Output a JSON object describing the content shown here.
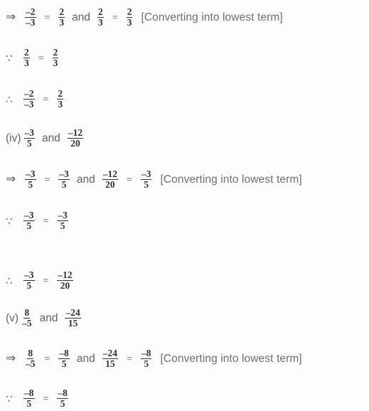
{
  "document": {
    "type": "math-solution",
    "topic": "Comparing rational numbers by converting into lowest terms",
    "background_color": "#fdfdfd",
    "math_text_color": "#2f3235",
    "prose_text_color": "#5f6368"
  },
  "symbols": {
    "implies": "⇒",
    "because": "∵",
    "therefore": "∴",
    "equals": "=",
    "and": "and"
  },
  "note_text": "[Converting into lowest term]",
  "lines": [
    {
      "id": "line-1",
      "kind": "implies",
      "symbol": "⇒",
      "left": {
        "num": "–2",
        "den": "–3"
      },
      "eq1": "=",
      "right": {
        "num": "2",
        "den": "3"
      },
      "conj": "and",
      "left2": {
        "num": "2",
        "den": "3"
      },
      "eq2": "=",
      "right2": {
        "num": "2",
        "den": "3"
      },
      "note": "[Converting into lowest term]"
    },
    {
      "id": "line-2",
      "kind": "because",
      "symbol": "∵",
      "left": {
        "num": "2",
        "den": "3"
      },
      "eq1": "=",
      "right": {
        "num": "2",
        "den": "3"
      }
    },
    {
      "id": "line-3",
      "kind": "therefore",
      "symbol": "∴",
      "left": {
        "num": "–2",
        "den": "–3"
      },
      "eq1": "=",
      "right": {
        "num": "2",
        "den": "3"
      }
    },
    {
      "id": "line-4",
      "kind": "question",
      "label": "(iv)",
      "left": {
        "num": "–3",
        "den": "5"
      },
      "conj": "and",
      "right": {
        "num": "–12",
        "den": "20"
      }
    },
    {
      "id": "line-5",
      "kind": "implies",
      "symbol": "⇒",
      "left": {
        "num": "–3",
        "den": "5"
      },
      "eq1": "=",
      "right": {
        "num": "–3",
        "den": "5"
      },
      "conj": "and",
      "left2": {
        "num": "–12",
        "den": "20"
      },
      "eq2": "=",
      "right2": {
        "num": "–3",
        "den": "5"
      },
      "note": "[Converting into lowest term]"
    },
    {
      "id": "line-6",
      "kind": "because",
      "symbol": "∵",
      "left": {
        "num": "–3",
        "den": "5"
      },
      "eq1": "=",
      "right": {
        "num": "–3",
        "den": "5"
      }
    },
    {
      "id": "line-7",
      "kind": "therefore",
      "symbol": "∴",
      "left": {
        "num": "–3",
        "den": "5"
      },
      "eq1": "=",
      "right": {
        "num": "–12",
        "den": "20"
      }
    },
    {
      "id": "line-8",
      "kind": "question",
      "label": "(v)",
      "left": {
        "num": "8",
        "den": "–5"
      },
      "conj": "and",
      "right": {
        "num": "–24",
        "den": "15"
      }
    },
    {
      "id": "line-9",
      "kind": "implies",
      "symbol": "⇒",
      "left": {
        "num": "8",
        "den": "–5"
      },
      "eq1": "=",
      "right": {
        "num": "–8",
        "den": "5"
      },
      "conj": "and",
      "left2": {
        "num": "–24",
        "den": "15"
      },
      "eq2": "=",
      "right2": {
        "num": "–8",
        "den": "5"
      },
      "note": "[Converting into lowest term]"
    },
    {
      "id": "line-10",
      "kind": "because",
      "symbol": "∵",
      "left": {
        "num": "–8",
        "den": "5"
      },
      "eq1": "=",
      "right": {
        "num": "–8",
        "den": "5"
      }
    }
  ]
}
